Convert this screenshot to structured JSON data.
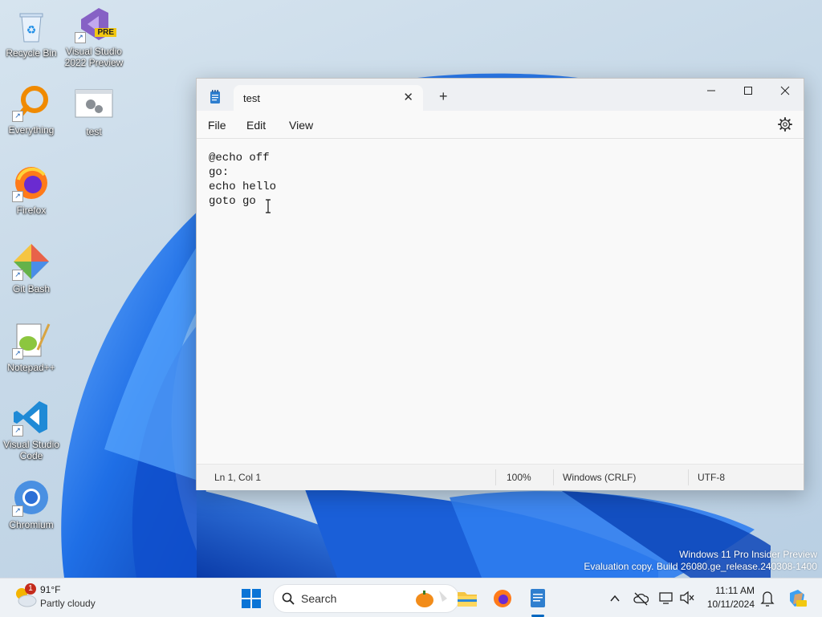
{
  "desktop": {
    "icons": [
      {
        "label": "Recycle Bin"
      },
      {
        "label": "Visual Studio 2022 Preview",
        "badge": "PRE"
      },
      {
        "label": "Everything"
      },
      {
        "label": "test"
      },
      {
        "label": "Firefox"
      },
      {
        "label": "Git Bash"
      },
      {
        "label": "Notepad++"
      },
      {
        "label": "Visual Studio Code"
      },
      {
        "label": "Chromium"
      }
    ],
    "watermark": {
      "line1": "Windows 11 Pro Insider Preview",
      "line2": "Evaluation copy. Build 26080.ge_release.240308-1400"
    }
  },
  "notepad": {
    "tab_title": "test",
    "menu": [
      "File",
      "Edit",
      "View"
    ],
    "content": "@echo off\ngo:\necho hello\ngoto go",
    "status": {
      "position": "Ln 1, Col 1",
      "zoom": "100%",
      "line_ending": "Windows (CRLF)",
      "encoding": "UTF-8"
    }
  },
  "taskbar": {
    "weather": {
      "temp": "91°F",
      "desc": "Partly cloudy",
      "notification_count": "1"
    },
    "search_placeholder": "Search",
    "clock": {
      "time": "11:11 AM",
      "date": "10/11/2024"
    }
  },
  "colors": {
    "accent": "#0067c0",
    "wallpaper_blue": "#1e6fe0"
  }
}
